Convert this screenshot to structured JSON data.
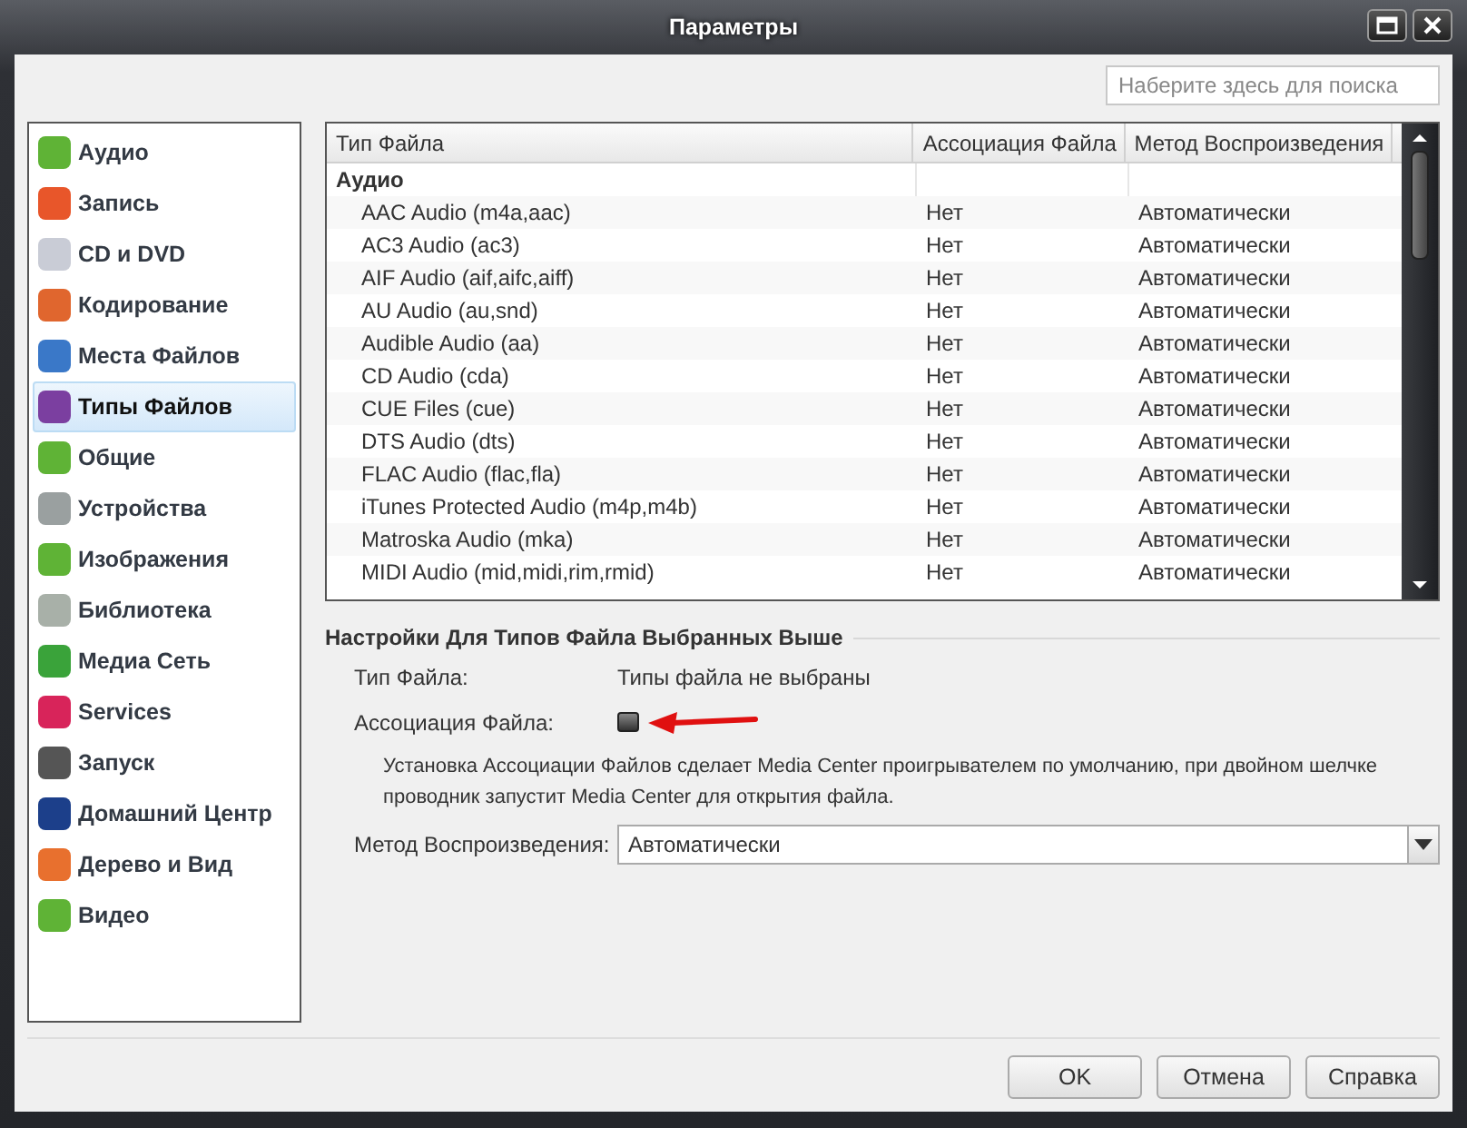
{
  "window": {
    "title": "Параметры"
  },
  "search": {
    "placeholder": "Наберите здесь для поиска"
  },
  "sidebar": {
    "items": [
      {
        "label": "Аудио",
        "selected": false,
        "color": "#5fb336"
      },
      {
        "label": "Запись",
        "selected": false,
        "color": "#e8562a"
      },
      {
        "label": "CD и DVD",
        "selected": false,
        "color": "#c9ccd6"
      },
      {
        "label": "Кодирование",
        "selected": false,
        "color": "#e0662e"
      },
      {
        "label": "Места Файлов",
        "selected": false,
        "color": "#3a78c8"
      },
      {
        "label": "Типы Файлов",
        "selected": true,
        "color": "#7b3fa0"
      },
      {
        "label": "Общие",
        "selected": false,
        "color": "#5fb336"
      },
      {
        "label": "Устройства",
        "selected": false,
        "color": "#9aa0a0"
      },
      {
        "label": "Изображения",
        "selected": false,
        "color": "#5fb336"
      },
      {
        "label": "Библиотека",
        "selected": false,
        "color": "#a8b0a8"
      },
      {
        "label": "Медиа Сеть",
        "selected": false,
        "color": "#3aa33a"
      },
      {
        "label": "Services",
        "selected": false,
        "color": "#d8245a"
      },
      {
        "label": "Запуск",
        "selected": false,
        "color": "#555555"
      },
      {
        "label": "Домашний Центр",
        "selected": false,
        "color": "#1c3f8a"
      },
      {
        "label": "Дерево и Вид",
        "selected": false,
        "color": "#e8702e"
      },
      {
        "label": "Видео",
        "selected": false,
        "color": "#5fb336"
      }
    ]
  },
  "table": {
    "columns": [
      "Тип Файла",
      "Ассоциация Файла",
      "Метод Воспроизведения"
    ],
    "groups": [
      {
        "name": "Аудио",
        "rows": [
          [
            "AAC Audio (m4a,aac)",
            "Нет",
            "Автоматически"
          ],
          [
            "AC3 Audio (ac3)",
            "Нет",
            "Автоматически"
          ],
          [
            "AIF Audio (aif,aifc,aiff)",
            "Нет",
            "Автоматически"
          ],
          [
            "AU Audio (au,snd)",
            "Нет",
            "Автоматически"
          ],
          [
            "Audible Audio (aa)",
            "Нет",
            "Автоматически"
          ],
          [
            "CD Audio (cda)",
            "Нет",
            "Автоматически"
          ],
          [
            "CUE Files (cue)",
            "Нет",
            "Автоматически"
          ],
          [
            "DTS Audio (dts)",
            "Нет",
            "Автоматически"
          ],
          [
            "FLAC Audio (flac,fla)",
            "Нет",
            "Автоматически"
          ],
          [
            "iTunes Protected Audio (m4p,m4b)",
            "Нет",
            "Автоматически"
          ],
          [
            "Matroska Audio (mka)",
            "Нет",
            "Автоматически"
          ],
          [
            "MIDI Audio (mid,midi,rim,rmid)",
            "Нет",
            "Автоматически"
          ]
        ]
      }
    ]
  },
  "settings": {
    "title": "Настройки Для Типов Файла Выбранных Выше",
    "file_type_label": "Тип Файла:",
    "file_type_value": "Типы файла не выбраны",
    "association_label": "Ассоциация Файла:",
    "association_checked": false,
    "note": "Установка Ассоциации Файлов сделает Media Center проигрывателем по умолчанию, при двойном шелчке проводник запустит Media Center для открытия файла.",
    "playback_label": "Метод Воспроизведения:",
    "playback_value": "Автоматически"
  },
  "buttons": [
    "OK",
    "Отмена",
    "Справка"
  ]
}
